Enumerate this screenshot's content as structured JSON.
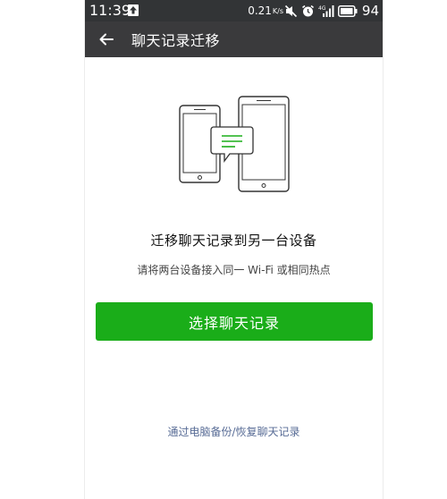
{
  "status_bar": {
    "time": "11:39",
    "network_speed": "0.21",
    "speed_unit": "K/s",
    "battery_level": "94",
    "icons": [
      "upload-notification-icon",
      "mute-icon",
      "alarm-icon",
      "signal-icon",
      "battery-icon"
    ]
  },
  "app_bar": {
    "back_icon": "arrow-left-icon",
    "title": "聊天记录迁移"
  },
  "main": {
    "illustration": "phones-transfer-chat-icon",
    "heading": "迁移聊天记录到另一台设备",
    "subheading": "请将两台设备接入同一 Wi-Fi 或相同热点",
    "primary_button": "选择聊天记录",
    "backup_link": "通过电脑备份/恢复聊天记录"
  },
  "colors": {
    "status_bar_bg": "#323436",
    "app_bar_bg": "#3a3a3c",
    "primary_green": "#1aad19",
    "link_blue": "#576b95"
  }
}
